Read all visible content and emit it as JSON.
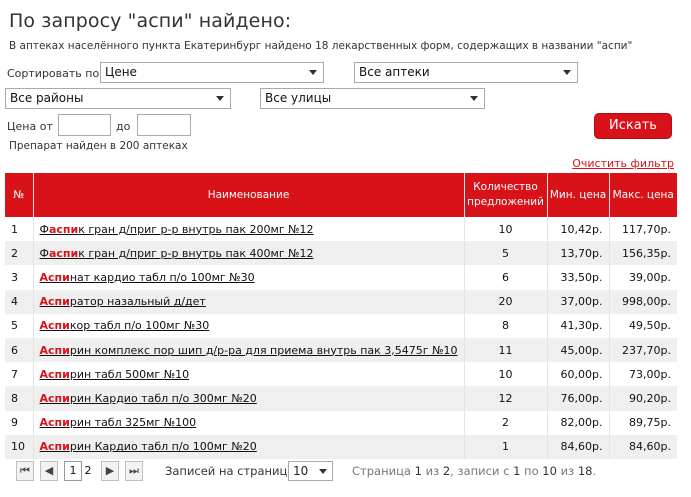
{
  "page": {
    "title": "По запросу \"аспи\" найдено:",
    "summary": "В аптеках населённого пункта Екатеринбург найдено 18 лекарственных форм, содержащих в названии \"аспи\"",
    "found_text": "Препарат найден в 200 аптеках",
    "clear_filter": "Очистить фильтр"
  },
  "filters": {
    "sort_label": "Сортировать по",
    "sort_value": "Цене",
    "pharmacy_value": "Все аптеки",
    "district_value": "Все районы",
    "street_value": "Все улицы",
    "price_from_label": "Цена от",
    "price_to_label": "до",
    "search_button": "Искать"
  },
  "table": {
    "headers": {
      "num": "№",
      "name": "Наименование",
      "offers": "Количество предложений",
      "min": "Мин. цена",
      "max": "Макс. цена"
    },
    "rows": [
      {
        "num": "1",
        "pre": "Ф",
        "hl": "аспи",
        "rest": "к гран д/приг р-р внутрь пак 200мг №12",
        "offers": "10",
        "min": "10,42р.",
        "max": "117,70р."
      },
      {
        "num": "2",
        "pre": "Ф",
        "hl": "аспи",
        "rest": "к гран д/приг р-р внутрь пак 400мг №12",
        "offers": "5",
        "min": "13,70р.",
        "max": "156,35р."
      },
      {
        "num": "3",
        "pre": "",
        "hl": "Аспи",
        "rest": "нат кардио табл п/о 100мг №30",
        "offers": "6",
        "min": "33,50р.",
        "max": "39,00р."
      },
      {
        "num": "4",
        "pre": "",
        "hl": "Аспи",
        "rest": "ратор назальный д/дет",
        "offers": "20",
        "min": "37,00р.",
        "max": "998,00р."
      },
      {
        "num": "5",
        "pre": "",
        "hl": "Аспи",
        "rest": "кор табл п/о 100мг №30",
        "offers": "8",
        "min": "41,30р.",
        "max": "49,50р."
      },
      {
        "num": "6",
        "pre": "",
        "hl": "Аспи",
        "rest": "рин комплекс пор шип д/р-ра для приема внутрь пак 3,5475г №10",
        "offers": "11",
        "min": "45,00р.",
        "max": "237,70р."
      },
      {
        "num": "7",
        "pre": "",
        "hl": "Аспи",
        "rest": "рин табл 500мг №10",
        "offers": "10",
        "min": "60,00р.",
        "max": "73,00р."
      },
      {
        "num": "8",
        "pre": "",
        "hl": "Аспи",
        "rest": "рин Кардио табл п/о 300мг №20",
        "offers": "12",
        "min": "76,00р.",
        "max": "90,20р."
      },
      {
        "num": "9",
        "pre": "",
        "hl": "Аспи",
        "rest": "рин табл 325мг №100",
        "offers": "2",
        "min": "82,00р.",
        "max": "89,75р."
      },
      {
        "num": "10",
        "pre": "",
        "hl": "Аспи",
        "rest": "рин Кардио табл п/о 100мг №20",
        "offers": "1",
        "min": "84,60р.",
        "max": "84,60р."
      }
    ]
  },
  "pager": {
    "first": "⏮",
    "prev": "◀",
    "page1": "1",
    "page2": "2",
    "next": "▶",
    "last": "⏭",
    "per_page_label": "Записей на странице:",
    "per_page_value": "10",
    "info_a": "Страница ",
    "info_page": "1",
    "info_b": " из ",
    "info_total_pages": "2",
    "info_c": ", записи с ",
    "info_from": "1",
    "info_d": " по ",
    "info_to": "10",
    "info_e": " из ",
    "info_total": "18",
    "info_f": "."
  },
  "colors": {
    "accent": "#d9121a",
    "row_alt": "#efefef"
  }
}
